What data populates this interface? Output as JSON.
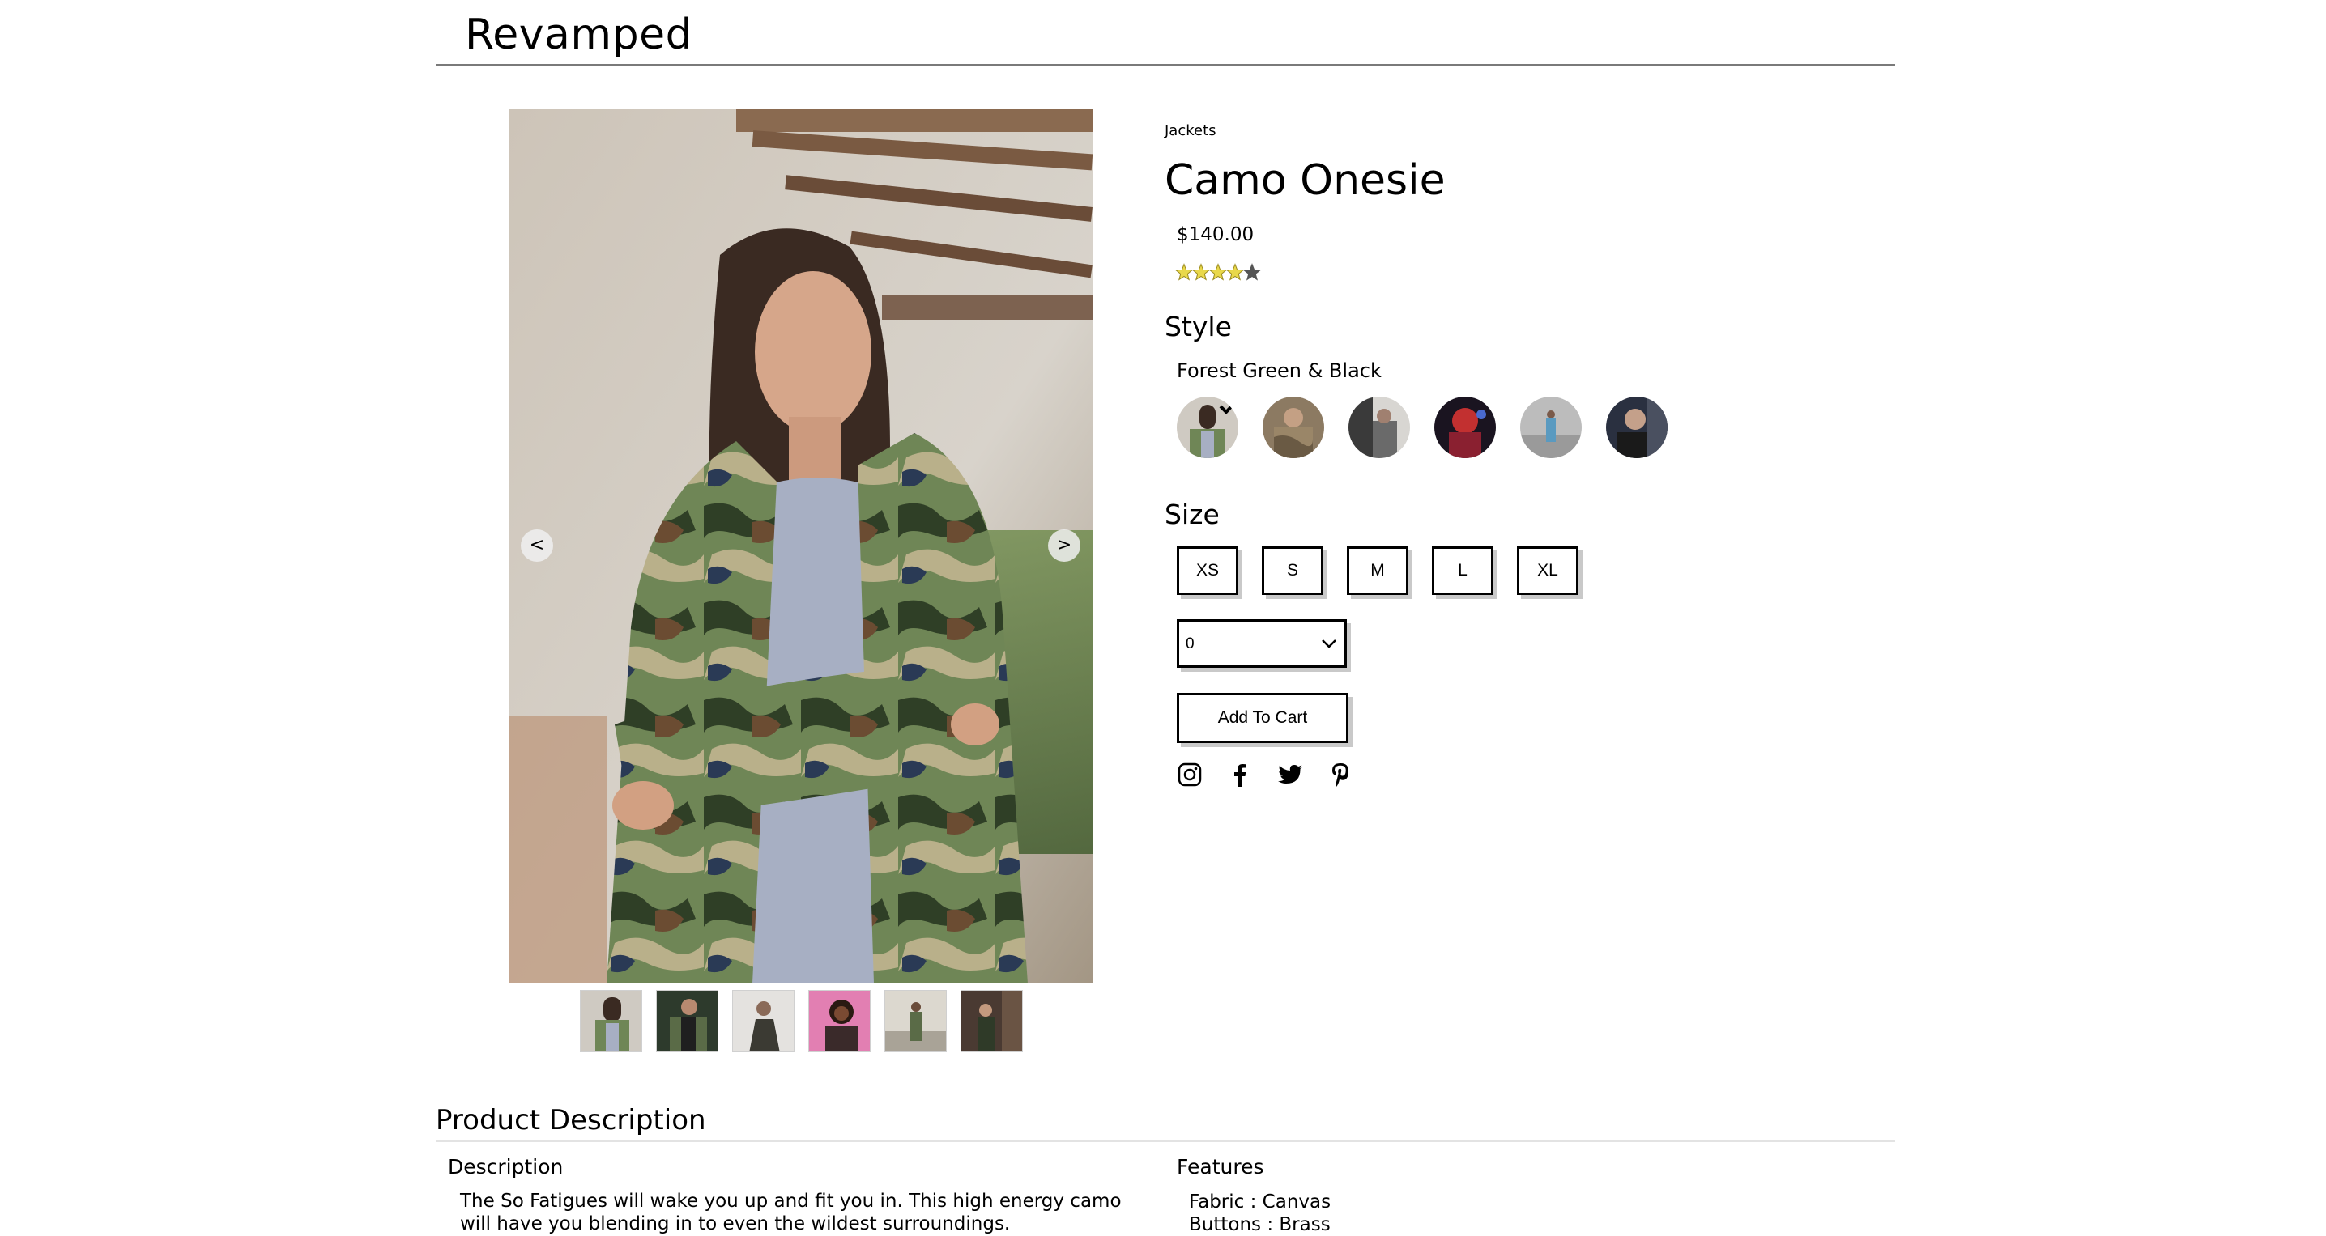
{
  "header": {
    "brand": "Revamped"
  },
  "gallery": {
    "prev_label": "<",
    "next_label": ">",
    "thumbnails": [
      "thumb-1",
      "thumb-2",
      "thumb-3",
      "thumb-4",
      "thumb-5",
      "thumb-6"
    ]
  },
  "product": {
    "category": "Jackets",
    "name": "Camo Onesie",
    "price": "$140.00",
    "rating": 4,
    "rating_max": 5,
    "style_heading": "Style",
    "selected_style": "Forest Green & Black",
    "size_heading": "Size",
    "sizes": [
      "XS",
      "S",
      "M",
      "L",
      "XL"
    ],
    "quantity": "0",
    "add_to_cart_label": "Add To Cart",
    "social": [
      "instagram-icon",
      "facebook-icon",
      "twitter-icon",
      "pinterest-icon"
    ]
  },
  "description_section": {
    "heading": "Product Description",
    "description_heading": "Description",
    "description_text": "The So Fatigues will wake you up and fit you in. This high energy camo will have you blending in to even the wildest surroundings.",
    "features_heading": "Features",
    "features": [
      "Fabric : Canvas",
      "Buttons : Brass"
    ]
  },
  "colors": {
    "accent_shadow": "#c9c9c9",
    "star_fill": "#e9d84a",
    "star_empty": "#555555",
    "rule": "#7a7a7a"
  }
}
